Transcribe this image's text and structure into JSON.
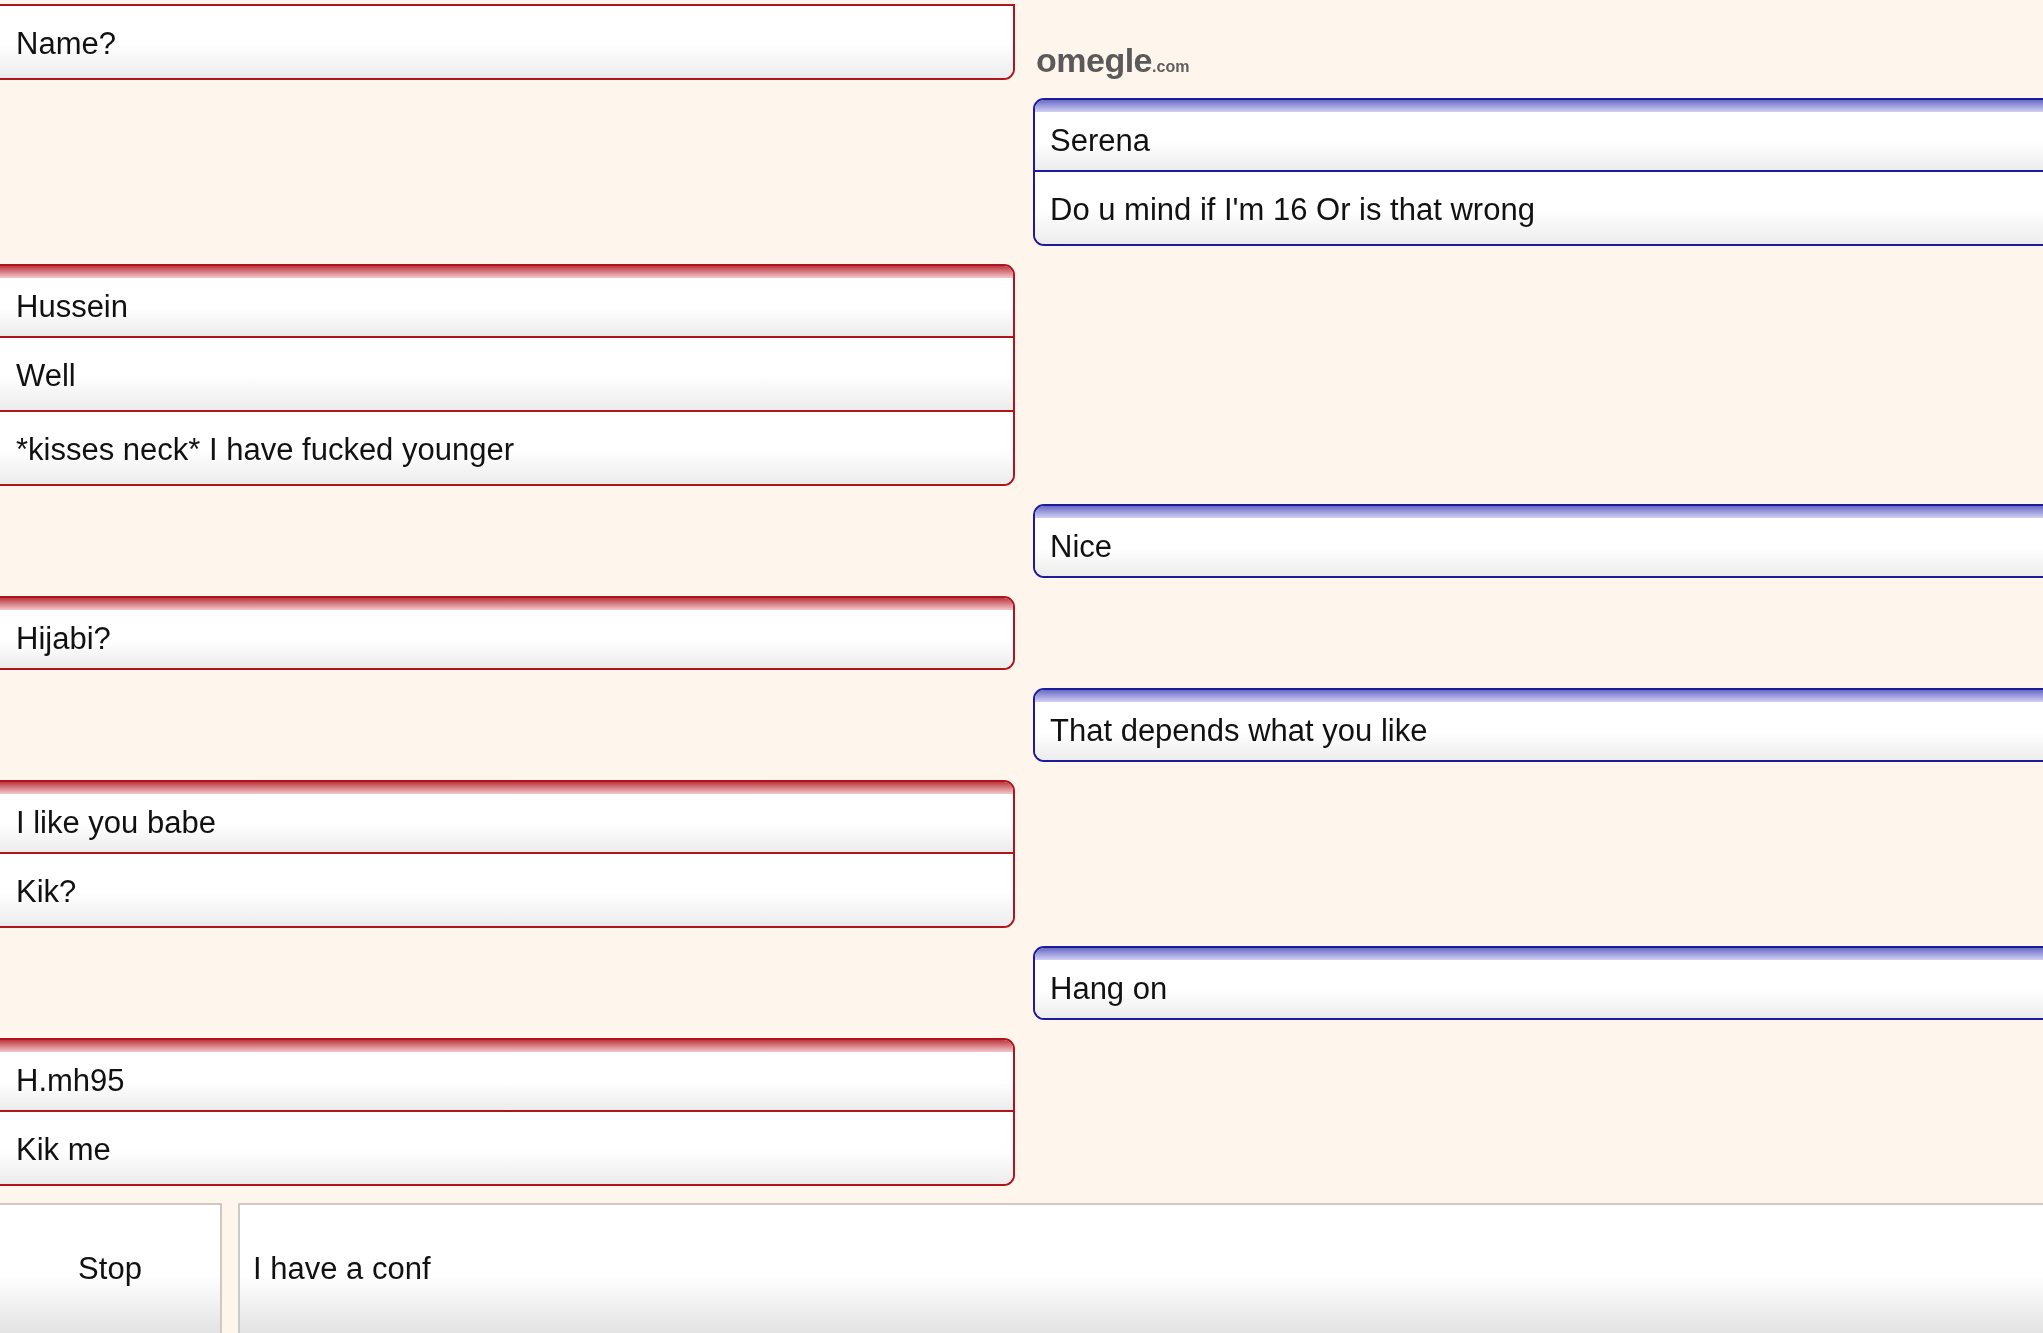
{
  "logo": {
    "name": "omegle",
    "domain": ".com"
  },
  "messages": [
    {
      "kind": "left",
      "continued": true,
      "lines": [
        "Name?"
      ]
    },
    {
      "kind": "right",
      "continued": false,
      "lines": [
        "Serena",
        "Do u mind if I'm 16 Or is that wrong"
      ]
    },
    {
      "kind": "left",
      "continued": false,
      "lines": [
        "Hussein",
        "Well",
        "*kisses neck* I have fucked younger"
      ]
    },
    {
      "kind": "right",
      "continued": false,
      "lines": [
        "Nice"
      ]
    },
    {
      "kind": "left",
      "continued": false,
      "lines": [
        "Hijabi?"
      ]
    },
    {
      "kind": "right",
      "continued": false,
      "lines": [
        "That depends what you like"
      ]
    },
    {
      "kind": "left",
      "continued": false,
      "lines": [
        "I like you babe",
        "Kik?"
      ]
    },
    {
      "kind": "right",
      "continued": false,
      "lines": [
        "Hang on"
      ]
    },
    {
      "kind": "left",
      "continued": false,
      "lines": [
        "H.mh95",
        "Kik me"
      ]
    }
  ],
  "composer": {
    "stop_button": "Stop",
    "message_input": {
      "value": "I have a conf"
    }
  }
}
